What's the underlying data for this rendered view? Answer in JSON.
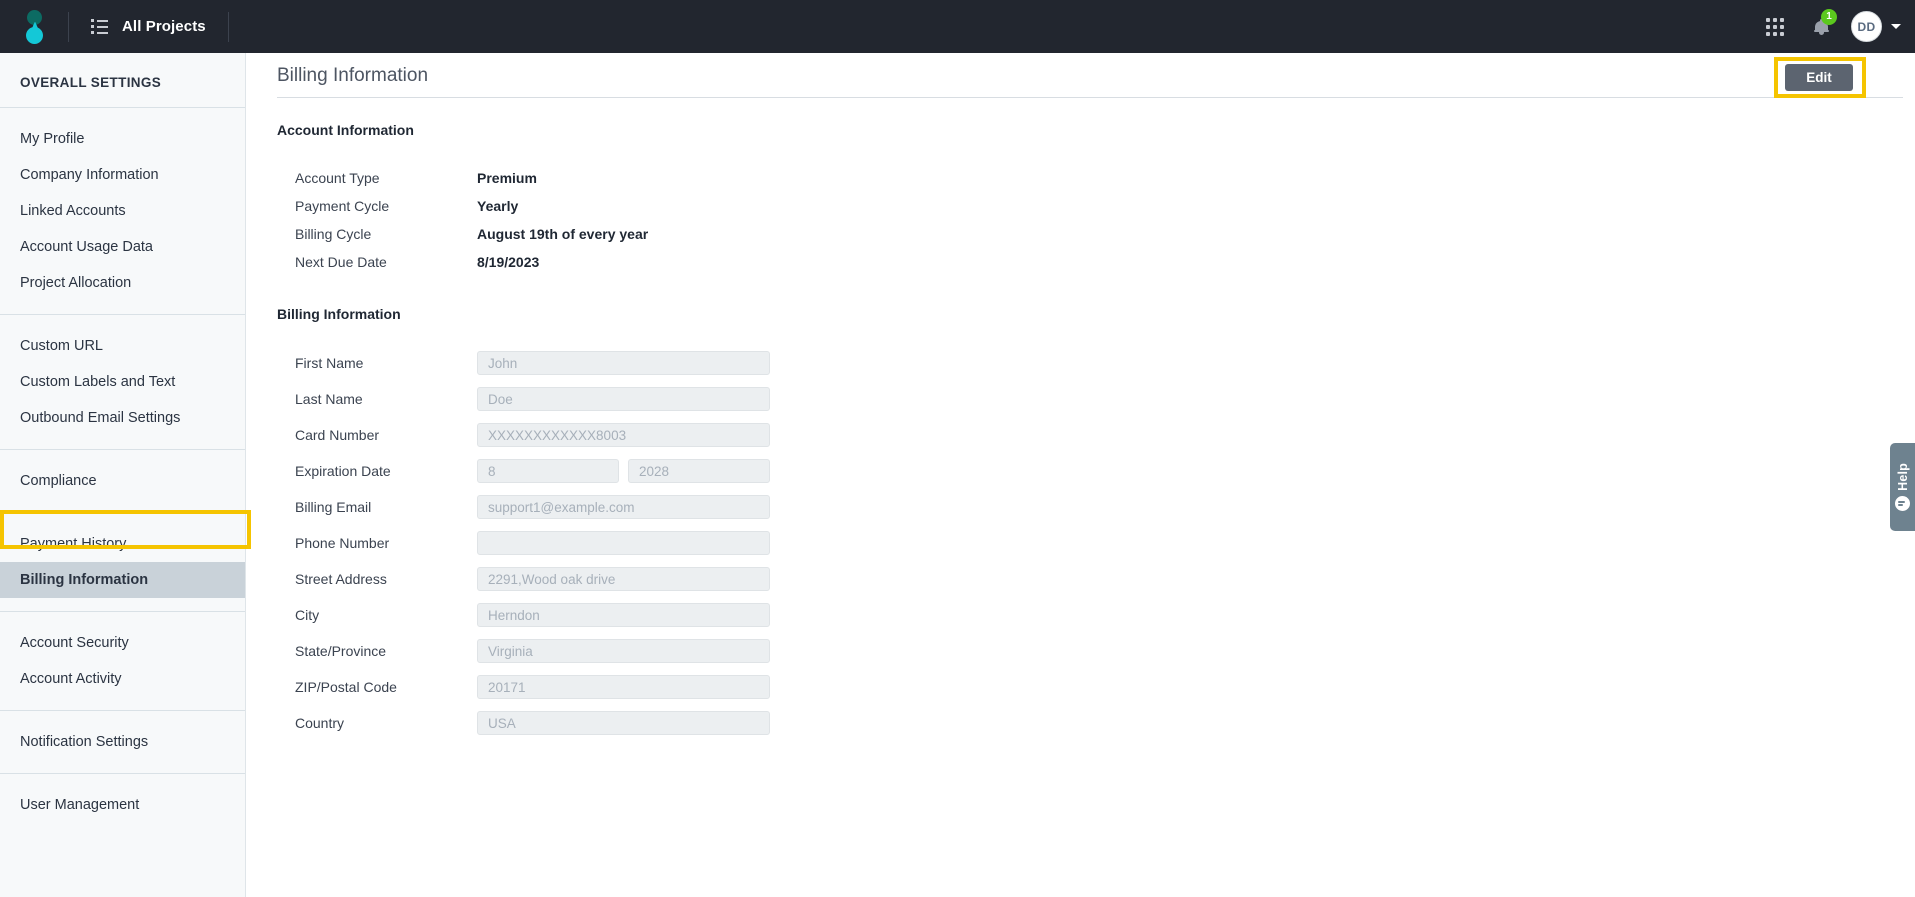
{
  "topbar": {
    "logo_name": "app-logo",
    "list_icon": "list-icon",
    "projects_label": "All Projects",
    "grid_icon": "apps-grid-icon",
    "bell_icon": "notifications-bell-icon",
    "notification_count": "1",
    "avatar_initials": "DD",
    "caret_icon": "chevron-down-icon",
    "accent_dark": "#22262f",
    "badge_green": "#5bc81e"
  },
  "sidebar": {
    "title": "OVERALL SETTINGS",
    "selected": "Billing Information",
    "highlight_color": "#f5c400",
    "groups": [
      {
        "items": [
          {
            "label": "My Profile"
          },
          {
            "label": "Company Information"
          },
          {
            "label": "Linked Accounts"
          },
          {
            "label": "Account Usage Data"
          },
          {
            "label": "Project Allocation"
          }
        ]
      },
      {
        "items": [
          {
            "label": "Custom URL"
          },
          {
            "label": "Custom Labels and Text"
          },
          {
            "label": "Outbound Email Settings"
          }
        ]
      },
      {
        "items": [
          {
            "label": "Compliance"
          }
        ]
      },
      {
        "items": [
          {
            "label": "Payment History"
          },
          {
            "label": "Billing Information"
          }
        ]
      },
      {
        "items": [
          {
            "label": "Account Security"
          },
          {
            "label": "Account Activity"
          }
        ]
      },
      {
        "items": [
          {
            "label": "Notification Settings"
          }
        ]
      },
      {
        "items": [
          {
            "label": "User Management"
          }
        ]
      }
    ]
  },
  "main": {
    "page_title": "Billing Information",
    "edit_label": "Edit",
    "account_section": {
      "title": "Account Information",
      "rows": [
        {
          "label": "Account Type",
          "value": "Premium"
        },
        {
          "label": "Payment Cycle",
          "value": "Yearly"
        },
        {
          "label": "Billing Cycle",
          "value": "August 19th of every year"
        },
        {
          "label": "Next Due Date",
          "value": "8/19/2023"
        }
      ]
    },
    "billing_section": {
      "title": "Billing Information",
      "fields": [
        {
          "label": "First Name",
          "value": "John"
        },
        {
          "label": "Last Name",
          "value": "Doe"
        },
        {
          "label": "Card Number",
          "value": "XXXXXXXXXXXX8003"
        },
        {
          "label": "Expiration Date",
          "month": "8",
          "year": "2028"
        },
        {
          "label": "Billing Email",
          "value": "support1@example.com"
        },
        {
          "label": "Phone Number",
          "value": ""
        },
        {
          "label": "Street Address",
          "value": "2291,Wood oak drive"
        },
        {
          "label": "City",
          "value": "Herndon"
        },
        {
          "label": "State/Province",
          "value": "Virginia"
        },
        {
          "label": "ZIP/Postal Code",
          "value": "20171"
        },
        {
          "label": "Country",
          "value": "USA"
        }
      ]
    }
  },
  "help_widget": {
    "label": "Help",
    "icon": "chat-bubble-icon"
  }
}
